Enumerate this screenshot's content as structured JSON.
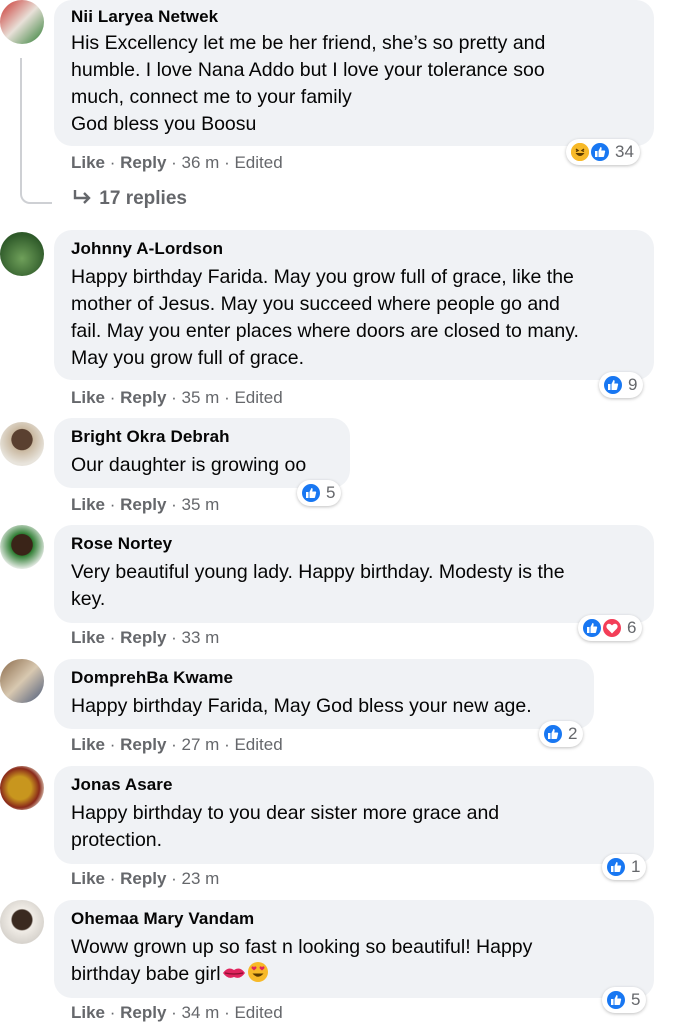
{
  "colors": {
    "bubble": "#f0f2f5",
    "text": "#050505",
    "meta": "#65676b",
    "like_blue": "#1877f2",
    "love_red": "#f33e58",
    "haha_yellow": "#f7b928"
  },
  "comments": [
    {
      "author": "Nii Laryea Netwek",
      "text": "His Excellency let me be her friend, she’s so pretty and\nhumble. I love Nana Addo but I love your tolerance soo\nmuch, connect me to your family\nGod bless you Boosu",
      "like": "Like",
      "reply": "Reply",
      "time": "36 m",
      "edited": "Edited",
      "reaction_count": "34",
      "reactions": [
        "haha-icon",
        "like-icon"
      ],
      "replies": "17 replies"
    },
    {
      "author": "Johnny A-Lordson",
      "text": "Happy birthday Farida. May you grow full of grace, like the\nmother of Jesus. May you succeed where people go and\nfail. May you enter places where doors are closed to many.\nMay you grow full of grace.",
      "like": "Like",
      "reply": "Reply",
      "time": "35 m",
      "edited": "Edited",
      "reaction_count": "9",
      "reactions": [
        "like-icon"
      ]
    },
    {
      "author": "Bright Okra Debrah",
      "text": "Our daughter is growing oo",
      "like": "Like",
      "reply": "Reply",
      "time": "35 m",
      "reaction_count": "5",
      "reactions": [
        "like-icon"
      ]
    },
    {
      "author": "Rose Nortey",
      "text": "Very beautiful young lady. Happy birthday. Modesty is the\nkey.",
      "like": "Like",
      "reply": "Reply",
      "time": "33 m",
      "reaction_count": "6",
      "reactions": [
        "like-icon",
        "love-icon"
      ]
    },
    {
      "author": "DomprehBa Kwame",
      "text": "Happy birthday Farida, May God bless your new age.",
      "like": "Like",
      "reply": "Reply",
      "time": "27 m",
      "edited": "Edited",
      "reaction_count": "2",
      "reactions": [
        "like-icon"
      ]
    },
    {
      "author": "Jonas Asare",
      "text": "Happy birthday to you dear sister more grace and\nprotection.",
      "like": "Like",
      "reply": "Reply",
      "time": "23 m",
      "reaction_count": "1",
      "reactions": [
        "like-icon"
      ]
    },
    {
      "author": "Ohemaa Mary Vandam",
      "text": "Woww grown up so fast n looking so beautiful! Happy\nbirthday babe girl",
      "like": "Like",
      "reply": "Reply",
      "time": "34 m",
      "edited": "Edited",
      "reaction_count": "5",
      "reactions": [
        "like-icon"
      ],
      "text_emojis": [
        "kiss-lips-icon",
        "heart-eyes-icon"
      ]
    }
  ]
}
